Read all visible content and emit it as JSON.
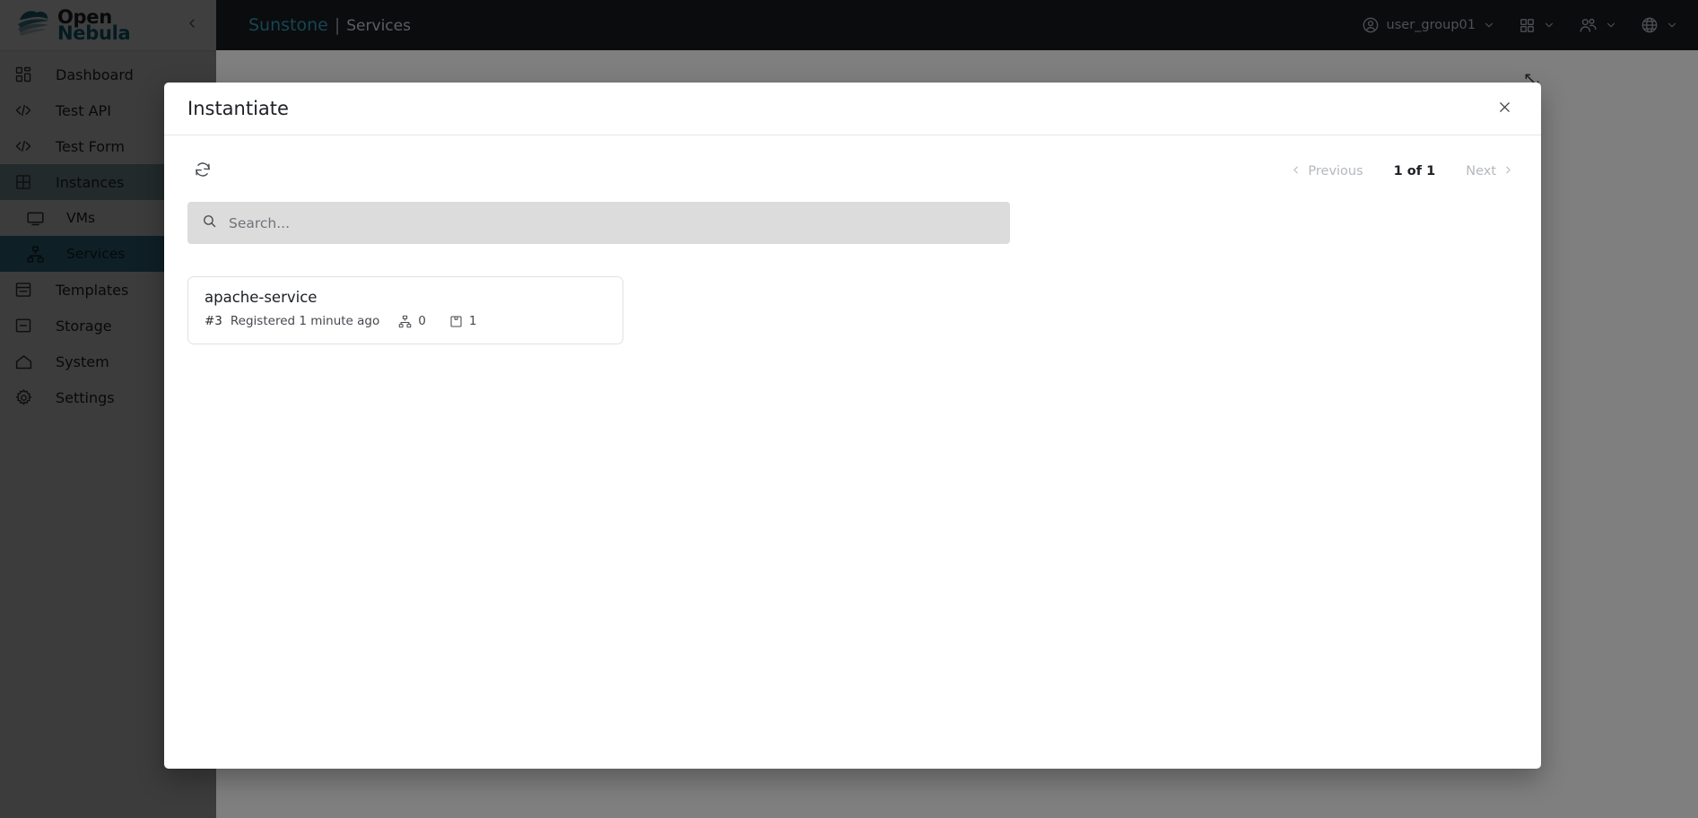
{
  "sidebar": {
    "logo": {
      "line1": "Open",
      "line2": "Nebula",
      "icon": "opennebula-cloud-logo"
    },
    "collapse_icon": "chevron-left-icon",
    "items": [
      {
        "label": "Dashboard",
        "icon": "dashboard-grid-icon",
        "state": "normal",
        "level": 0
      },
      {
        "label": "Test API",
        "icon": "code-brackets-icon",
        "state": "normal",
        "level": 0
      },
      {
        "label": "Test Form",
        "icon": "code-brackets-icon",
        "state": "normal",
        "level": 0
      },
      {
        "label": "Instances",
        "icon": "grid-four-icon",
        "state": "parent-active",
        "level": 0
      },
      {
        "label": "VMs",
        "icon": "monitor-icon",
        "state": "normal",
        "level": 1
      },
      {
        "label": "Services",
        "icon": "network-tree-icon",
        "state": "active",
        "level": 1
      },
      {
        "label": "Templates",
        "icon": "archive-box-icon",
        "state": "normal",
        "level": 0
      },
      {
        "label": "Storage",
        "icon": "storage-drive-icon",
        "state": "normal",
        "level": 0
      },
      {
        "label": "System",
        "icon": "home-icon",
        "state": "normal",
        "level": 0
      },
      {
        "label": "Settings",
        "icon": "gear-icon",
        "state": "normal",
        "level": 0
      }
    ]
  },
  "topbar": {
    "app_name": "Sunstone",
    "separator": "|",
    "section": "Services",
    "user": {
      "label": "user_group01",
      "icon": "user-circle-icon",
      "chevron": "chevron-down-icon"
    },
    "views_menu": {
      "icon": "grid-squares-icon",
      "chevron": "chevron-down-icon"
    },
    "group_menu": {
      "icon": "users-icon",
      "chevron": "chevron-down-icon"
    },
    "language_menu": {
      "icon": "globe-icon",
      "chevron": "chevron-down-icon"
    }
  },
  "content": {
    "expand_icon": "expand-external-icon"
  },
  "modal": {
    "title": "Instantiate",
    "close_icon": "close-x-icon",
    "refresh_icon": "refresh-icon",
    "pagination": {
      "previous_label": "Previous",
      "previous_icon": "chevron-left-icon",
      "page_indicator": "1 of 1",
      "next_label": "Next",
      "next_icon": "chevron-right-icon"
    },
    "search": {
      "placeholder": "Search...",
      "value": "",
      "icon": "search-icon"
    },
    "cards": [
      {
        "name": "apache-service",
        "id": "#3",
        "registered": "Registered 1 minute ago",
        "roles_icon": "network-tree-icon",
        "roles_count": "0",
        "vms_icon": "box-package-icon",
        "vms_count": "1"
      }
    ]
  },
  "colors": {
    "brand_teal": "#0f6a82",
    "topbar_bg": "#15181d",
    "sidebar_active": "#3f7f99",
    "sidebar_parent_active": "#8fa8b3",
    "sunstone_teal": "#2e8aa6",
    "search_bg": "#dcdcdc"
  }
}
